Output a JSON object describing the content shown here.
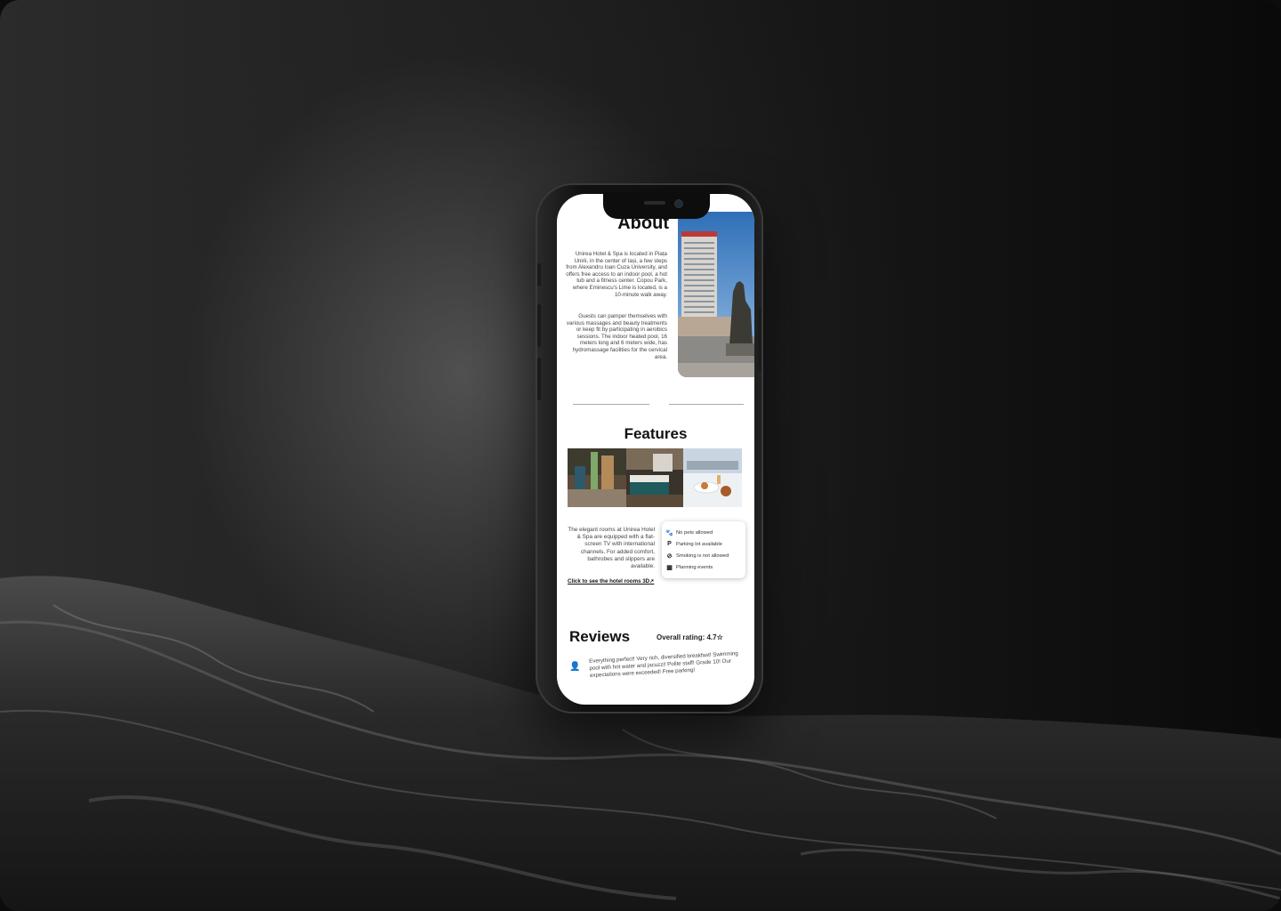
{
  "about": {
    "title": "About",
    "paragraph1": "Unirea Hotel & Spa is located in Piața Unirii, in the center of Iași, a few steps from Alexandru Ioan Cuza University, and offers free access to an indoor pool, a hot tub and a fitness center. Copou Park, where Eminescu's Lime is located, is a 10-minute walk away.",
    "paragraph2": "Guests can pamper themselves with various massages and beauty treatments or keep fit by participating in aerobics sessions. The indoor heated pool, 16 meters long and 6 meters wide, has hydromassage facilities for the cervical area."
  },
  "features": {
    "title": "Features",
    "description": "The elegant rooms at Unirea Hotel & Spa are equipped with a flat-screen TV with international channels. For added comfort, bathrobes and slippers are available.",
    "rooms_link": "Click to see the hotel rooms 3D",
    "amenities": [
      {
        "icon": "paw-icon",
        "label": "No pets allowed"
      },
      {
        "icon": "parking-icon",
        "label": "Parking lot available"
      },
      {
        "icon": "no-smoking-icon",
        "label": "Smoking is not allowed"
      },
      {
        "icon": "calendar-icon",
        "label": "Planning events"
      }
    ]
  },
  "reviews": {
    "title": "Reviews",
    "overall_rating": "Overall rating: 4.7☆",
    "items": [
      {
        "text": "Everything perfect! Very rich, diversified breakfast! Swimming pool with hot water and jacuzzi! Polite staff! Grade 10! Our expectations were exceeded! Free parking!"
      }
    ]
  }
}
